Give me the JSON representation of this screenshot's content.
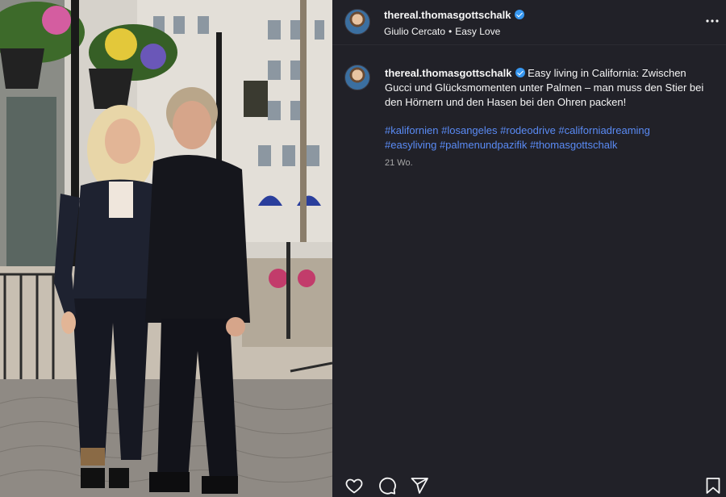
{
  "post": {
    "username": "thereal.thomasgottschalk",
    "verified": true,
    "music_artist": "Giulio Cercato",
    "music_separator": "•",
    "music_title": "Easy Love",
    "caption_username": "thereal.thomasgottschalk",
    "caption": "Easy living in California: Zwischen Gucci und Glücksmomenten unter Palmen – man muss den Stier bei den Hörnern und den Hasen bei den Ohren packen!",
    "hashtags": [
      "#kalifornien",
      "#losangeles",
      "#rodeodrive",
      "#californiadreaming",
      "#easyliving",
      "#palmenundpazifik",
      "#thomasgottschalk"
    ],
    "age": "21 Wo."
  },
  "icons": {
    "more": "more-options-icon",
    "like": "heart-icon",
    "comment": "comment-icon",
    "share": "share-icon",
    "save": "bookmark-icon",
    "verified": "verified-badge-icon"
  },
  "colors": {
    "panel_bg": "#212128",
    "link": "#5a8bf5",
    "verified": "#3797f0",
    "muted": "#a8a8a8"
  }
}
